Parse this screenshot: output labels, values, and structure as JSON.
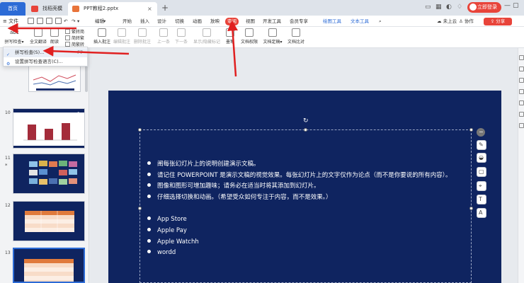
{
  "tabs": {
    "home": "首页",
    "tab1": "找稻壳模板",
    "tab2": "PPT教程2.pptx",
    "add": "+",
    "close": "×"
  },
  "login": "立即登录",
  "menu": {
    "file": "文件",
    "edit": "编辑",
    "items": [
      "开始",
      "插入",
      "设计",
      "切换",
      "动画",
      "放映",
      "审阅",
      "视图",
      "开发工具",
      "会员专享"
    ],
    "active_index": 6,
    "context_tools": [
      "绘图工具",
      "文本工具"
    ],
    "right": [
      "未上云",
      "协作",
      "分享"
    ]
  },
  "ribbon": {
    "spell_check": "拼写检查",
    "translate": "全文翻译",
    "read": "朗读",
    "trad_simp": "繁转简",
    "simp_trad": "简转繁",
    "trad_simp2": "简繁转",
    "insert_comment": "插入批注",
    "edit_comment": "编辑批注",
    "delete_comment": "删除批注",
    "prev": "上一条",
    "next": "下一条",
    "show_markup": "显示/隐藏标记",
    "ink": "墨笔",
    "doc_rights": "文档权限",
    "doc_finalize": "文档定稿",
    "doc_compare": "文档比对"
  },
  "dropdown": {
    "items": [
      {
        "label": "拼写检查(S)...",
        "shortcut": "F7"
      },
      {
        "label": "设置拼写检查语言(C)...",
        "shortcut": ""
      }
    ]
  },
  "thumbnails": {
    "numbers": [
      "10",
      "11",
      "12",
      "13"
    ],
    "star": "*"
  },
  "slide": {
    "bullets": [
      "阐每张幻灯片上的说明创建演示文稿。",
      "请记住 POWERPOINT 是演示文稿的视觉效果。每张幻灯片上的文字仅作为论点（而不是你要说的所有内容）。",
      "图像和图形可增加趣味；请务必在适当时将其添加到幻灯片。",
      "仔细选择切换和动画。（希望受众如何专注于内容，而不是效果。）"
    ],
    "items": [
      "App Store",
      "Apple Pay",
      "Apple Watchh",
      "wordd"
    ]
  },
  "colors": {
    "accent": "#e8443a",
    "brand": "#2c6bd6",
    "slide_bg": "#0f2460"
  }
}
